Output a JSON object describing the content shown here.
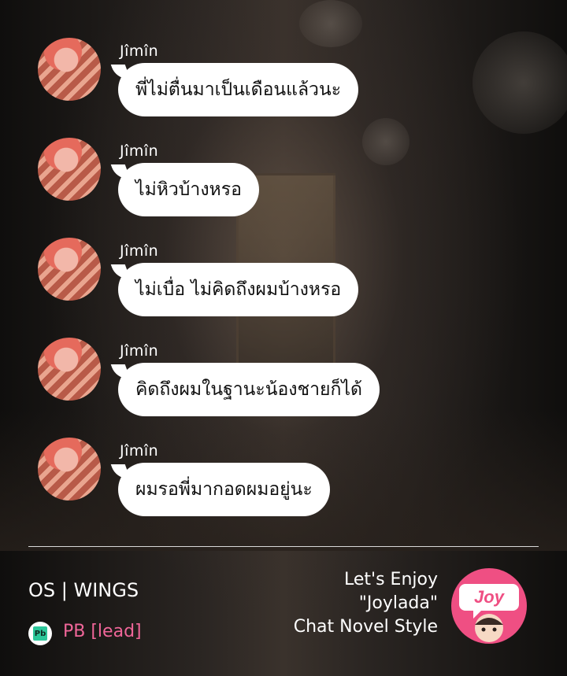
{
  "messages": [
    {
      "sender": "Jîmîn",
      "text": "พี่ไม่ตื่นมาเป็นเดือนแล้วนะ"
    },
    {
      "sender": "Jîmîn",
      "text": "ไม่หิวบ้างหรอ"
    },
    {
      "sender": "Jîmîn",
      "text": "ไม่เบื่อ ไม่คิดถึงผมบ้างหรอ"
    },
    {
      "sender": "Jîmîn",
      "text": "คิดถึงผมในฐานะน้องชายก็ได้"
    },
    {
      "sender": "Jîmîn",
      "text": "ผมรอพี่มากอดผมอยู่นะ"
    }
  ],
  "footer": {
    "title": "OS | WINGS",
    "pb_icon_label": "Pb",
    "pb_text": "PB [lead]",
    "enjoy_line1": "Let's Enjoy",
    "enjoy_line2": "\"Joylada\"",
    "enjoy_line3": "Chat Novel Style",
    "logo_text": "Joy"
  },
  "colors": {
    "bubble": "#ffffff",
    "pb_text": "#f06699",
    "logo_pink": "#ef4f83"
  }
}
